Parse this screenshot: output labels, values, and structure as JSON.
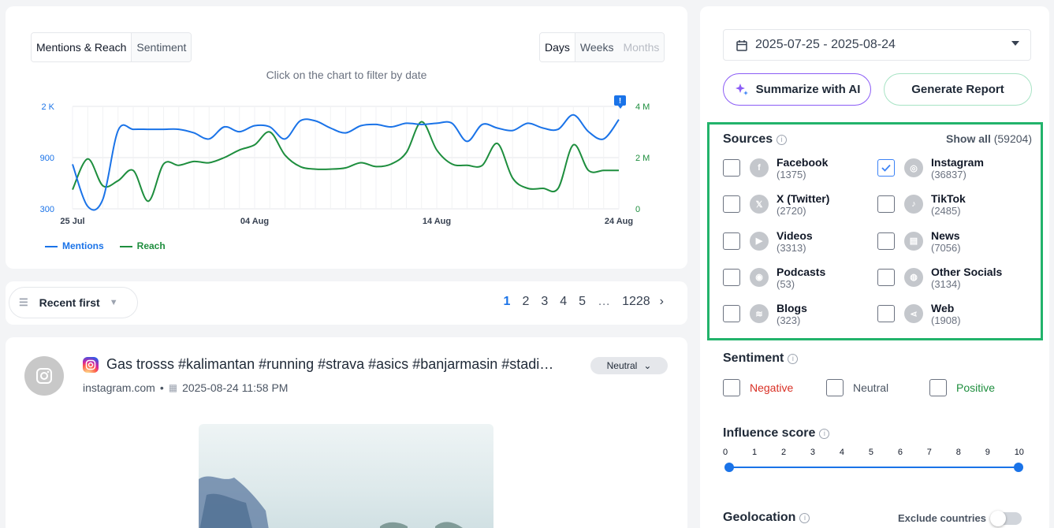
{
  "chart_panel": {
    "tabs": [
      {
        "label": "Mentions & Reach",
        "active": true
      },
      {
        "label": "Sentiment",
        "active": false
      }
    ],
    "granularity": [
      {
        "label": "Days",
        "active": true
      },
      {
        "label": "Weeks",
        "active": false
      },
      {
        "label": "Months",
        "disabled": true
      }
    ],
    "hint": "Click on the chart to filter by date",
    "legend": [
      "Mentions",
      "Reach"
    ]
  },
  "chart_data": {
    "type": "line",
    "x_tick_labels": [
      "25 Jul",
      "04 Aug",
      "14 Aug",
      "24 Aug"
    ],
    "y_left_ticks": [
      "2 K",
      "900",
      "300"
    ],
    "y_right_ticks": [
      "4 M",
      "2 M",
      "0"
    ],
    "series": [
      {
        "name": "Mentions",
        "color": "#1a73e8",
        "axis": "left",
        "values": [
          1040,
          340,
          460,
          1600,
          1620,
          1620,
          1620,
          1620,
          1560,
          1460,
          1660,
          1580,
          1680,
          1660,
          1460,
          1760,
          1760,
          1640,
          1560,
          1680,
          1700,
          1660,
          1720,
          1700,
          1720,
          1720,
          1420,
          1700,
          1640,
          1600,
          1720,
          1640,
          1620,
          1860,
          1580,
          1460,
          1780
        ]
      },
      {
        "name": "Reach",
        "color": "#1e8e3e",
        "axis": "right",
        "values": [
          0.75,
          1.95,
          0.9,
          1.1,
          1.5,
          0.3,
          1.75,
          1.7,
          1.85,
          1.8,
          2.0,
          2.3,
          2.5,
          3.0,
          2.1,
          1.65,
          1.55,
          1.55,
          1.6,
          1.8,
          1.65,
          1.75,
          2.2,
          3.4,
          2.3,
          1.75,
          1.7,
          1.7,
          2.55,
          1.2,
          0.8,
          0.8,
          0.8,
          2.5,
          1.5,
          1.5,
          1.5
        ]
      }
    ],
    "y_left_range": [
      300,
      2000
    ],
    "y_right_range": [
      0,
      4
    ],
    "grid": true,
    "legend_position": "bottom-left"
  },
  "sort": {
    "label": "Recent first"
  },
  "pagination": {
    "pages": [
      "1",
      "2",
      "3",
      "4",
      "5",
      "…",
      "1228"
    ],
    "current": "1"
  },
  "post": {
    "title": "Gas trosss #kalimantan #running #strava #asics #banjarmasin #stadi…",
    "source": "instagram.com",
    "separator": "•",
    "datetime": "2025-08-24 11:58 PM",
    "sentiment": "Neutral"
  },
  "filters": {
    "date_range": "2025-07-25 - 2025-08-24",
    "ai_button": "Summarize with AI",
    "report_button": "Generate Report",
    "sources_title": "Sources",
    "show_all_label": "Show all",
    "show_all_count": "(59204)",
    "sources": [
      {
        "name": "Facebook",
        "count": "(1375)",
        "checked": false,
        "icon": "facebook-icon",
        "glyph": "f"
      },
      {
        "name": "Instagram",
        "count": "(36837)",
        "checked": true,
        "icon": "instagram-icon",
        "glyph": "◎"
      },
      {
        "name": "X (Twitter)",
        "count": "(2720)",
        "checked": false,
        "icon": "x-icon",
        "glyph": "𝕏"
      },
      {
        "name": "TikTok",
        "count": "(2485)",
        "checked": false,
        "icon": "tiktok-icon",
        "glyph": "♪"
      },
      {
        "name": "Videos",
        "count": "(3313)",
        "checked": false,
        "icon": "play-icon",
        "glyph": "▶"
      },
      {
        "name": "News",
        "count": "(7056)",
        "checked": false,
        "icon": "newspaper-icon",
        "glyph": "▤"
      },
      {
        "name": "Podcasts",
        "count": "(53)",
        "checked": false,
        "icon": "podcast-icon",
        "glyph": "◉"
      },
      {
        "name": "Other Socials",
        "count": "(3134)",
        "checked": false,
        "icon": "chat-icon",
        "glyph": "◍"
      },
      {
        "name": "Blogs",
        "count": "(323)",
        "checked": false,
        "icon": "rss-icon",
        "glyph": "≋"
      },
      {
        "name": "Web",
        "count": "(1908)",
        "checked": false,
        "icon": "share-icon",
        "glyph": "⋖"
      }
    ],
    "sentiment_title": "Sentiment",
    "sentiment_options": [
      {
        "label": "Negative",
        "color": "#d93025"
      },
      {
        "label": "Neutral",
        "color": "#4b5563"
      },
      {
        "label": "Positive",
        "color": "#1e8e3e"
      }
    ],
    "influence_title": "Influence score",
    "influence_scale": [
      "0",
      "1",
      "2",
      "3",
      "4",
      "5",
      "6",
      "7",
      "8",
      "9",
      "10"
    ],
    "influence_range": [
      0,
      10
    ],
    "geolocation_title": "Geolocation",
    "exclude_countries_label": "Exclude countries",
    "exclude_countries_on": false
  }
}
